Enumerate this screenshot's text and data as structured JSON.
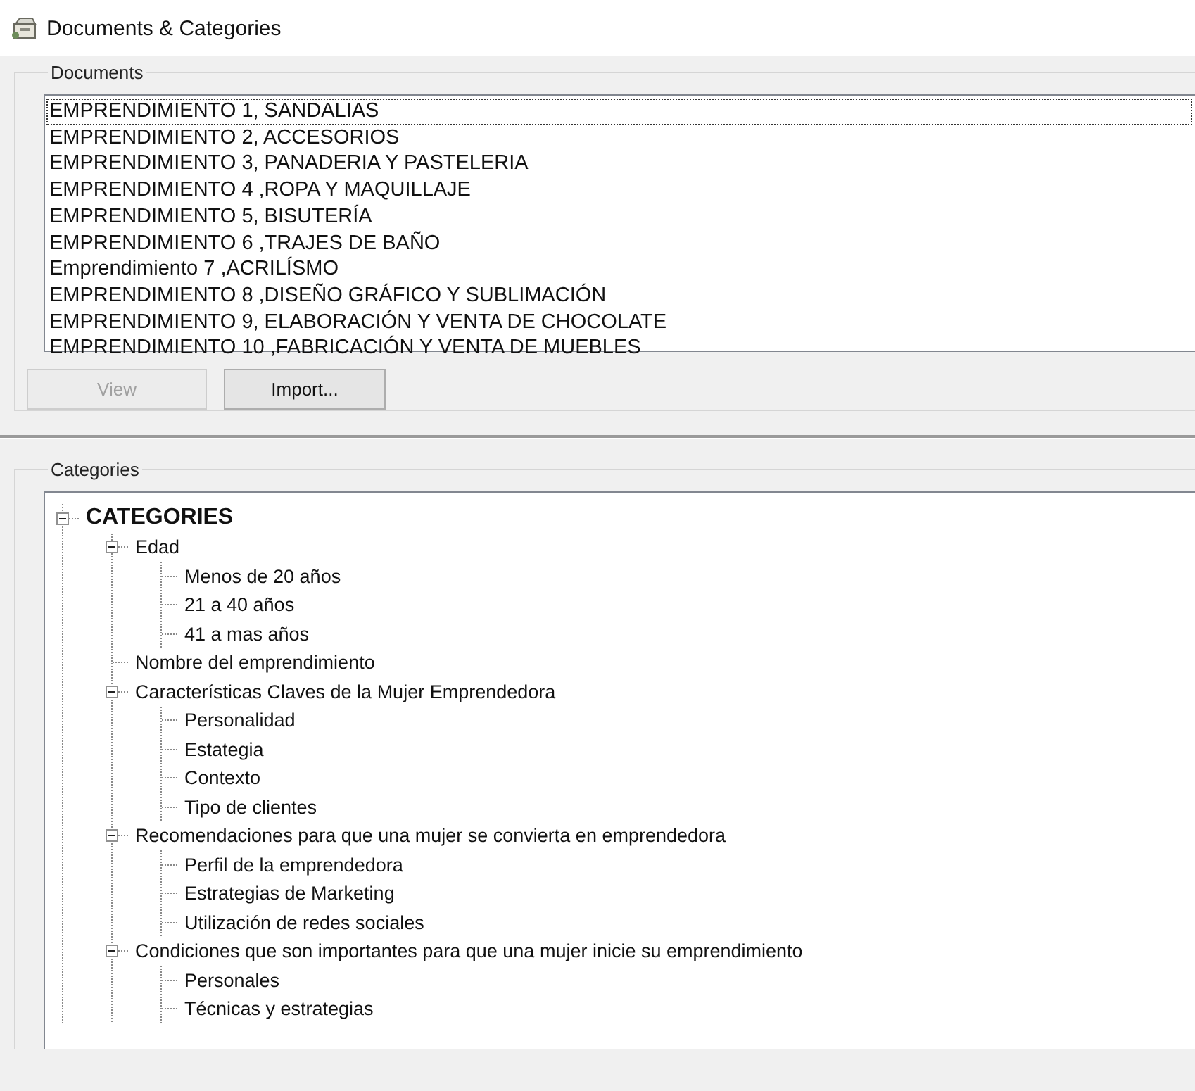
{
  "window": {
    "title": "Documents & Categories"
  },
  "documents": {
    "label": "Documents",
    "items": [
      {
        "text": "EMPRENDIMIENTO 1, SANDALIAS",
        "selected": true
      },
      {
        "text": "EMPRENDIMIENTO 2, ACCESORIOS",
        "selected": false
      },
      {
        "text": "EMPRENDIMIENTO 3, PANADERIA Y PASTELERIA",
        "selected": false
      },
      {
        "text": "EMPRENDIMIENTO 4 ,ROPA Y MAQUILLAJE",
        "selected": false
      },
      {
        "text": "EMPRENDIMIENTO 5, BISUTERÍA",
        "selected": false
      },
      {
        "text": "EMPRENDIMIENTO 6 ,TRAJES DE BAÑO",
        "selected": false
      },
      {
        "text": "Emprendimiento 7 ,ACRILÍSMO",
        "selected": false
      },
      {
        "text": "EMPRENDIMIENTO 8 ,DISEÑO GRÁFICO Y SUBLIMACIÓN",
        "selected": false
      },
      {
        "text": "EMPRENDIMIENTO 9, ELABORACIÓN Y VENTA DE CHOCOLATE",
        "selected": false
      },
      {
        "text": "EMPRENDIMIENTO 10 ,FABRICACIÓN Y VENTA DE MUEBLES",
        "selected": false
      }
    ],
    "buttons": [
      {
        "label": "View",
        "disabled": true
      },
      {
        "label": "Import...",
        "disabled": false
      }
    ]
  },
  "categories": {
    "label": "Categories",
    "tree": [
      {
        "text": "CATEGORIES",
        "expanded": true,
        "children": [
          {
            "text": "Edad",
            "expanded": true,
            "children": [
              {
                "text": "Menos de 20 años"
              },
              {
                "text": "21 a 40 años"
              },
              {
                "text": "41 a mas años"
              }
            ]
          },
          {
            "text": "Nombre del emprendimiento"
          },
          {
            "text": "Características Claves de la Mujer Emprendedora",
            "expanded": true,
            "children": [
              {
                "text": "Personalidad"
              },
              {
                "text": "Estategia"
              },
              {
                "text": "Contexto"
              },
              {
                "text": "Tipo de clientes"
              }
            ]
          },
          {
            "text": "Recomendaciones para que una mujer se convierta en emprendedora",
            "expanded": true,
            "children": [
              {
                "text": "Perfil de la emprendedora"
              },
              {
                "text": "Estrategias de Marketing"
              },
              {
                "text": "Utilización de redes sociales"
              }
            ]
          },
          {
            "text": "Condiciones que son importantes para que una mujer inicie su emprendimiento",
            "expanded": true,
            "children": [
              {
                "text": "Personales"
              },
              {
                "text": "Técnicas y estrategias"
              }
            ]
          }
        ]
      }
    ]
  }
}
